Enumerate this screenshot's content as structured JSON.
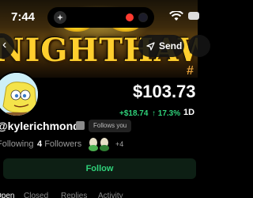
{
  "status_bar": {
    "time": "7:44"
  },
  "banner": {
    "headline": "NIGHTHAWK"
  },
  "actions": {
    "send_label": "Send"
  },
  "profile": {
    "username": "@kylerichmond",
    "follows_you_label": "Follows you",
    "following_label": "Following",
    "followers_count": "4",
    "followers_label": "Followers",
    "mutual_more": "+4"
  },
  "market": {
    "hash_label": "#",
    "price": "$103.73",
    "change_abs": "+$18.74",
    "change_pct": "↑ 17.3%",
    "range": "1D"
  },
  "follow_button": {
    "label": "Follow"
  },
  "tabs": [
    {
      "label": "Open"
    },
    {
      "label": "Closed"
    },
    {
      "label": "Replies"
    },
    {
      "label": "Activity"
    }
  ],
  "colors": {
    "positive": "#2fd27a",
    "banner_gold": "#ffcf2e"
  },
  "icons": [
    "app-icon",
    "wifi-icon",
    "back-arrow-icon",
    "send-icon",
    "verified-icon",
    "mutual-avatars-icon"
  ]
}
